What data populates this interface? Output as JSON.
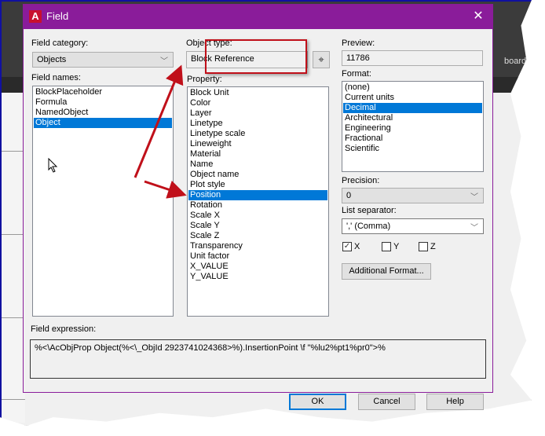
{
  "background": {
    "ribbon_partial_label": "board"
  },
  "dialog": {
    "title": "Field",
    "app_icon_glyph": "A",
    "close_glyph": "✕",
    "field_category": {
      "label": "Field category:",
      "selected": "Objects"
    },
    "field_names": {
      "label": "Field names:",
      "items": [
        "BlockPlaceholder",
        "Formula",
        "NamedObject",
        "Object"
      ],
      "selected_index": 3
    },
    "object_type": {
      "label": "Object type:",
      "value": "Block Reference",
      "select_object_icon": "crosshair-icon"
    },
    "property": {
      "label": "Property:",
      "items": [
        "Block Unit",
        "Color",
        "Layer",
        "Linetype",
        "Linetype scale",
        "Lineweight",
        "Material",
        "Name",
        "Object name",
        "Plot style",
        "Position",
        "Rotation",
        "Scale X",
        "Scale Y",
        "Scale Z",
        "Transparency",
        "Unit factor",
        "X_VALUE",
        "Y_VALUE"
      ],
      "selected_index": 10
    },
    "preview": {
      "label": "Preview:",
      "value": "11786"
    },
    "format": {
      "label": "Format:",
      "items": [
        "(none)",
        "Current units",
        "Decimal",
        "Architectural",
        "Engineering",
        "Fractional",
        "Scientific"
      ],
      "selected_index": 2
    },
    "precision": {
      "label": "Precision:",
      "selected": "0"
    },
    "list_separator": {
      "label": "List separator:",
      "selected": "',' (Comma)"
    },
    "axes": [
      {
        "label": "X",
        "checked": true
      },
      {
        "label": "Y",
        "checked": false
      },
      {
        "label": "Z",
        "checked": false
      }
    ],
    "additional_format_button": "Additional Format...",
    "field_expression": {
      "label": "Field expression:",
      "value": "%<\\AcObjProp Object(%<\\_ObjId 2923741024368>%).InsertionPoint \\f \"%lu2%pt1%pr0\">%"
    },
    "buttons": {
      "ok": "OK",
      "cancel": "Cancel",
      "help": "Help"
    }
  },
  "annotation_color": "#c0101a",
  "title_bar_color": "#8a1c9a",
  "selection_color": "#0078d7"
}
